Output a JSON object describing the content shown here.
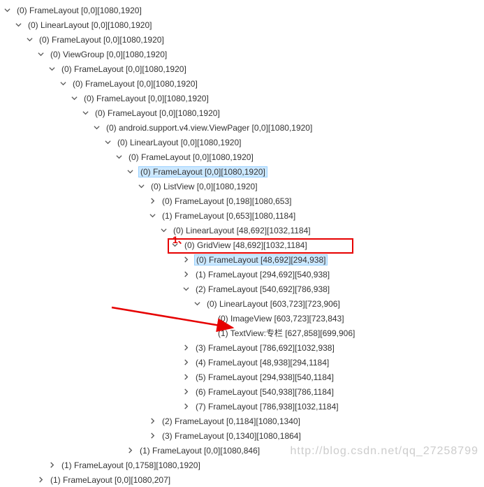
{
  "tree": [
    {
      "depth": 0,
      "state": "expanded",
      "text": "(0) FrameLayout [0,0][1080,1920]",
      "name": "node-framelayout-0"
    },
    {
      "depth": 1,
      "state": "expanded",
      "text": "(0) LinearLayout [0,0][1080,1920]",
      "name": "node-linearlayout-1"
    },
    {
      "depth": 2,
      "state": "expanded",
      "text": "(0) FrameLayout [0,0][1080,1920]",
      "name": "node-framelayout-2"
    },
    {
      "depth": 3,
      "state": "expanded",
      "text": "(0) ViewGroup [0,0][1080,1920]",
      "name": "node-viewgroup-3"
    },
    {
      "depth": 4,
      "state": "expanded",
      "text": "(0) FrameLayout [0,0][1080,1920]",
      "name": "node-framelayout-4"
    },
    {
      "depth": 5,
      "state": "expanded",
      "text": "(0) FrameLayout [0,0][1080,1920]",
      "name": "node-framelayout-5"
    },
    {
      "depth": 6,
      "state": "expanded",
      "text": "(0) FrameLayout [0,0][1080,1920]",
      "name": "node-framelayout-6"
    },
    {
      "depth": 7,
      "state": "expanded",
      "text": "(0) FrameLayout [0,0][1080,1920]",
      "name": "node-framelayout-7"
    },
    {
      "depth": 8,
      "state": "expanded",
      "text": "(0) android.support.v4.view.ViewPager [0,0][1080,1920]",
      "name": "node-viewpager-8"
    },
    {
      "depth": 9,
      "state": "expanded",
      "text": "(0) LinearLayout [0,0][1080,1920]",
      "name": "node-linearlayout-9"
    },
    {
      "depth": 10,
      "state": "expanded",
      "text": "(0) FrameLayout [0,0][1080,1920]",
      "name": "node-framelayout-10"
    },
    {
      "depth": 11,
      "state": "expanded",
      "text": "(0) FrameLayout [0,0][1080,1920]",
      "name": "node-framelayout-11",
      "selected": true
    },
    {
      "depth": 12,
      "state": "expanded",
      "text": "(0) ListView [0,0][1080,1920]",
      "name": "node-listview-12"
    },
    {
      "depth": 13,
      "state": "collapsed",
      "text": "(0) FrameLayout [0,198][1080,653]",
      "name": "node-framelayout-13"
    },
    {
      "depth": 13,
      "state": "expanded",
      "text": "(1) FrameLayout [0,653][1080,1184]",
      "name": "node-framelayout-14"
    },
    {
      "depth": 14,
      "state": "expanded",
      "text": "(0) LinearLayout [48,692][1032,1184]",
      "name": "node-linearlayout-15"
    },
    {
      "depth": 15,
      "state": "expanded",
      "text": "(0) GridView [48,692][1032,1184]",
      "name": "node-gridview-16",
      "boxed": true
    },
    {
      "depth": 16,
      "state": "collapsed",
      "text": "(0) FrameLayout [48,692][294,938]",
      "name": "node-framelayout-17",
      "selected": true
    },
    {
      "depth": 16,
      "state": "collapsed",
      "text": "(1) FrameLayout [294,692][540,938]",
      "name": "node-framelayout-18"
    },
    {
      "depth": 16,
      "state": "expanded",
      "text": "(2) FrameLayout [540,692][786,938]",
      "name": "node-framelayout-19"
    },
    {
      "depth": 17,
      "state": "expanded",
      "text": "(0) LinearLayout [603,723][723,906]",
      "name": "node-linearlayout-20"
    },
    {
      "depth": 18,
      "state": "leaf",
      "text": "(0) ImageView [603,723][723,843]",
      "name": "node-imageview-21"
    },
    {
      "depth": 18,
      "state": "leaf",
      "text": "(1) TextView:专栏 [627,858][699,906]",
      "name": "node-textview-22",
      "arrowed": true
    },
    {
      "depth": 16,
      "state": "collapsed",
      "text": "(3) FrameLayout [786,692][1032,938]",
      "name": "node-framelayout-23"
    },
    {
      "depth": 16,
      "state": "collapsed",
      "text": "(4) FrameLayout [48,938][294,1184]",
      "name": "node-framelayout-24"
    },
    {
      "depth": 16,
      "state": "collapsed",
      "text": "(5) FrameLayout [294,938][540,1184]",
      "name": "node-framelayout-25"
    },
    {
      "depth": 16,
      "state": "collapsed",
      "text": "(6) FrameLayout [540,938][786,1184]",
      "name": "node-framelayout-26"
    },
    {
      "depth": 16,
      "state": "collapsed",
      "text": "(7) FrameLayout [786,938][1032,1184]",
      "name": "node-framelayout-27"
    },
    {
      "depth": 13,
      "state": "collapsed",
      "text": "(2) FrameLayout [0,1184][1080,1340]",
      "name": "node-framelayout-28"
    },
    {
      "depth": 13,
      "state": "collapsed",
      "text": "(3) FrameLayout [0,1340][1080,1864]",
      "name": "node-framelayout-29"
    },
    {
      "depth": 11,
      "state": "collapsed",
      "text": "(1) FrameLayout [0,0][1080,846]",
      "name": "node-framelayout-30"
    },
    {
      "depth": 4,
      "state": "collapsed",
      "text": "(1) FrameLayout [0,1758][1080,1920]",
      "name": "node-framelayout-31"
    },
    {
      "depth": 3,
      "state": "collapsed",
      "text": "(1) FrameLayout [0,0][1080,207]",
      "name": "node-framelayout-32"
    }
  ],
  "annotations": {
    "label1": "1、"
  },
  "watermark": "http://blog.csdn.net/qq_27258799"
}
